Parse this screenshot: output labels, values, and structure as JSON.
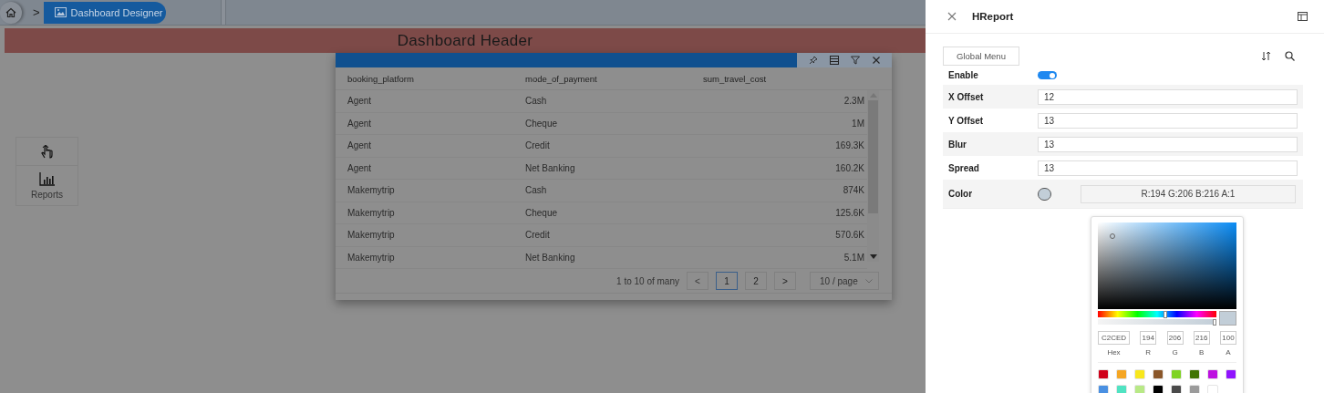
{
  "breadcrumb": {
    "separator": ">",
    "items": [
      {
        "label": "Dashboard Designer"
      }
    ]
  },
  "header": {
    "title": "Dashboard Header"
  },
  "toolbox": {
    "items": [
      {
        "kind": "touch"
      },
      {
        "kind": "chart",
        "label": "Reports"
      }
    ]
  },
  "table": {
    "columns": [
      "booking_platform",
      "mode_of_payment",
      "sum_travel_cost"
    ],
    "rows": [
      [
        "Agent",
        "Cash",
        "2.3M"
      ],
      [
        "Agent",
        "Cheque",
        "1M"
      ],
      [
        "Agent",
        "Credit",
        "169.3K"
      ],
      [
        "Agent",
        "Net Banking",
        "160.2K"
      ],
      [
        "Makemytrip",
        "Cash",
        "874K"
      ],
      [
        "Makemytrip",
        "Cheque",
        "125.6K"
      ],
      [
        "Makemytrip",
        "Credit",
        "570.6K"
      ],
      [
        "Makemytrip",
        "Net Banking",
        "5.1M"
      ]
    ],
    "pagination": {
      "summary": "1 to 10 of many",
      "prev": "<",
      "next": ">",
      "page_size": "10 / page",
      "pages": [
        {
          "label": "1",
          "selected": true
        },
        {
          "label": "2",
          "selected": false
        }
      ]
    }
  },
  "panel": {
    "title": "HReport",
    "button": "Global Menu",
    "properties": [
      {
        "kind": "toggle",
        "label": "Enable",
        "on": true
      },
      {
        "kind": "input",
        "label": "X Offset",
        "value": "12"
      },
      {
        "kind": "input",
        "label": "Y Offset",
        "value": "13"
      },
      {
        "kind": "input",
        "label": "Blur",
        "value": "13"
      },
      {
        "kind": "input",
        "label": "Spread",
        "value": "13"
      },
      {
        "kind": "color",
        "label": "Color",
        "color": "#c2ced8",
        "value": "R:194 G:206 B:216 A:1"
      }
    ]
  },
  "picker": {
    "hue": {
      "level": 0.57
    },
    "alpha": {
      "level": 1
    },
    "hex": {
      "value": "C2CED",
      "label": "Hex"
    },
    "channels": [
      {
        "label": "R",
        "value": "194"
      },
      {
        "label": "G",
        "value": "206"
      },
      {
        "label": "B",
        "value": "216"
      },
      {
        "label": "A",
        "value": "100"
      }
    ],
    "swatches": [
      {
        "color": "#d0021b"
      },
      {
        "color": "#f5a623"
      },
      {
        "color": "#f8e71c"
      },
      {
        "color": "#8b572a"
      },
      {
        "color": "#7ed321"
      },
      {
        "color": "#417505"
      },
      {
        "color": "#bd10e0"
      },
      {
        "color": "#9013fe"
      },
      {
        "color": "#4a90e2"
      },
      {
        "color": "#50e3c2"
      },
      {
        "color": "#b8e986"
      },
      {
        "color": "#000000"
      },
      {
        "color": "#4a4a4a"
      },
      {
        "color": "#9b9b9b"
      },
      {
        "color": "#ffffff"
      }
    ]
  }
}
